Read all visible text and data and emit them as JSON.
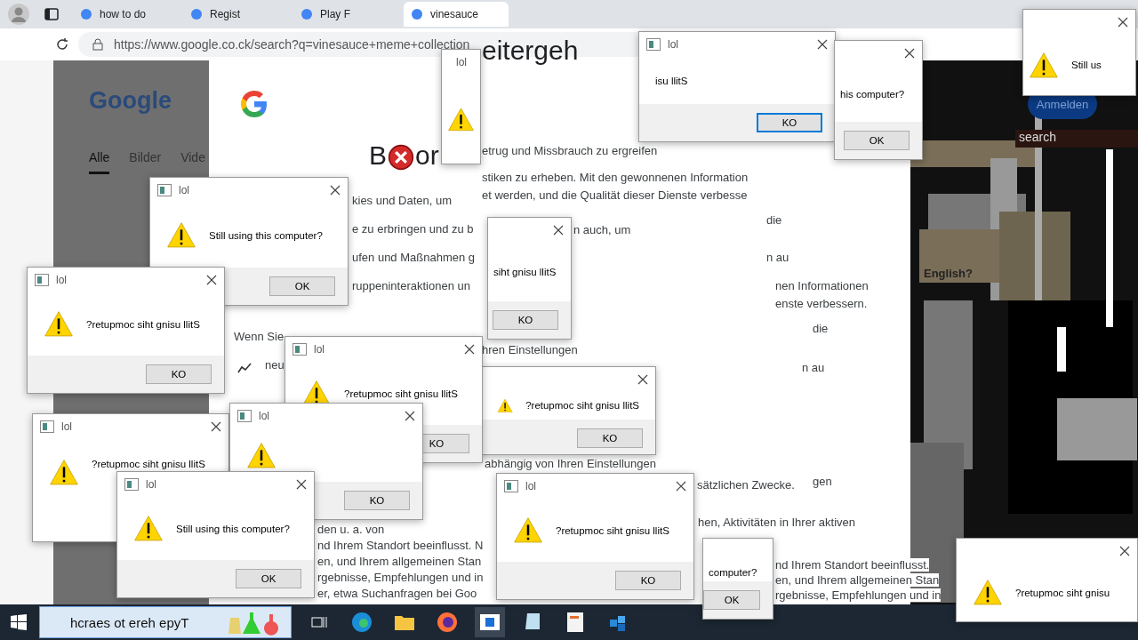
{
  "browser": {
    "tabs": [
      {
        "title": "how to do",
        "selected": false
      },
      {
        "title": "Regist",
        "selected": false
      },
      {
        "title": "Play F",
        "selected": false
      },
      {
        "title": "vinesauce",
        "selected": true
      }
    ],
    "url": "https://www.google.co.ck/search?q=vinesauce+meme+collection"
  },
  "google": {
    "logo": "Google",
    "tabs": [
      {
        "label": "Alle",
        "selected": true
      },
      {
        "label": "Bilder",
        "selected": false
      },
      {
        "label": "Vide",
        "selected": false
      }
    ],
    "sign_in": "Anmelden",
    "search": "search",
    "language": "English?"
  },
  "consent": {
    "heading_top": "eitergeh",
    "heading_a": "B",
    "heading_b": "or",
    "lines": [
      "kies und Daten, um",
      "e zu erbringen und zu b",
      "ufen und Maßnahmen g",
      "ruppeninteraktionen un",
      "Wenn Sie",
      "neu",
      "hren Einstellungen",
      "abhängig von Ihren Einstellungen",
      "sätzlichen Zwecke.",
      "den u. a. von",
      "nd Ihrem Standort beeinflusst. N",
      "en, und Ihrem allgemeinen Stan",
      "rgebnisse, Empfehlungen und in",
      "er, etwa Suchanfragen bei Goo",
      "etrug und Missbrauch zu ergreifen",
      "stiken zu erheben. Mit den gewonnenen Information",
      "et werden, und die Qualität dieser Dienste verbesse",
      "die",
      "n auch, um",
      "n au",
      "nen Informationen",
      "enste verbessern.",
      "die",
      "n au",
      "gen",
      "hen, Aktivitäten in Ihrer aktiven",
      "nd Ihrem Standort beeinflusst.",
      "en, und Ihrem allgemeinen Stan",
      "rgebnisse, Empfehlungen und in"
    ]
  },
  "dialogs": [
    {
      "title": "lol",
      "icon": true
    },
    {
      "title": "lol",
      "message": "isu llitS",
      "button": "KO",
      "focused": true,
      "icon": false
    },
    {
      "message": "his computer?",
      "button": "OK",
      "focused": false,
      "icon": false
    },
    {
      "message": "Still us",
      "icon": true
    },
    {
      "title": "lol",
      "message": "Still using this computer?",
      "button": "OK",
      "focused": false,
      "icon": true
    },
    {
      "title": "lol",
      "message": "?retupmoc siht gnisu llitS",
      "button": "KO",
      "focused": false,
      "icon": true
    },
    {
      "message": "siht gnisu llitS",
      "button": "KO",
      "focused": false,
      "icon": false
    },
    {
      "message": "?retupmoc siht gnisu llitS",
      "button": "KO",
      "focused": false,
      "icon": true
    },
    {
      "title": "lol",
      "message": "?retupmoc siht gnisu llitS",
      "button": "KO",
      "focused": false,
      "icon": true
    },
    {
      "title": "lol",
      "message": "?retupmoc siht gnisu llitS",
      "icon": true
    },
    {
      "title": "lol",
      "button": "KO",
      "focused": false,
      "icon": true
    },
    {
      "title": "lol",
      "message": "Still using this computer?",
      "button": "OK",
      "focused": false,
      "icon": true
    },
    {
      "title": "lol",
      "message": "?retupmoc siht gnisu llitS",
      "button": "KO",
      "focused": false,
      "icon": true
    },
    {
      "message": "computer?",
      "button": "OK",
      "focused": false,
      "icon": false
    },
    {
      "message": "?retupmoc siht gnisu",
      "icon": true
    }
  ],
  "taskbar": {
    "search": {
      "value": "hcraes ot ereh epyT"
    }
  }
}
